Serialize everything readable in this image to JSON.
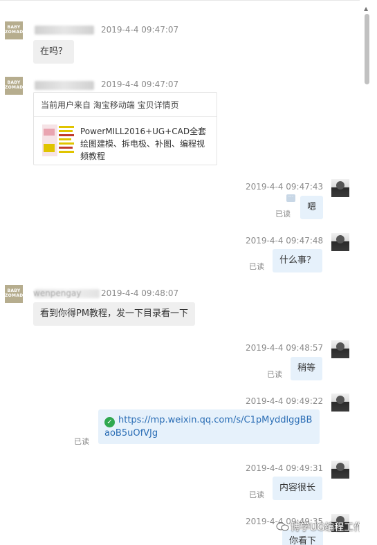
{
  "messages": {
    "m1": {
      "time": "2019-4-4 09:47:07",
      "text": "在吗？"
    },
    "m2": {
      "time": "2019-4-4 09:47:07",
      "card_header": "当前用户来自 淘宝移动端 宝贝详情页",
      "card_title": "PowerMILL2016+UG+CAD全套绘图建模、拆电极、补图、编程视频教程"
    },
    "m3": {
      "time": "2019-4-4 09:47:43",
      "text": "嗯",
      "read": "已读"
    },
    "m4": {
      "time": "2019-4-4 09:47:48",
      "text": "什么事？",
      "read": "已读"
    },
    "m5": {
      "sender_partial": "wenpengay",
      "time": "2019-4-4 09:48:07",
      "text": "看到你得PM教程，发一下目录看一下"
    },
    "m6": {
      "time": "2019-4-4 09:48:57",
      "text": "稍等",
      "read": "已读"
    },
    "m7": {
      "time": "2019-4-4 09:49:22",
      "link": "https://mp.weixin.qq.com/s/C1pMyddlggBBaoB5uOfVJg",
      "read": "已读"
    },
    "m8": {
      "time": "2019-4-4 09:49:31",
      "text": "内容很长",
      "read": "已读"
    },
    "m9": {
      "time": "2019-4-4 09:49:35",
      "text": "你看下"
    }
  },
  "avatars": {
    "shop_text": "BABY ZOMADE"
  },
  "icons": {
    "check": "check-circle-icon",
    "typing": "typing-indicator-icon",
    "scroll_up": "scroll-up-arrow-icon",
    "watermark": "wechat-icon"
  },
  "watermark": "博学UG编程工作室",
  "colors": {
    "incoming_bubble": "#efefef",
    "outgoing_bubble": "#e6f1fb",
    "link": "#2a6db5",
    "check": "#2fa84f"
  }
}
